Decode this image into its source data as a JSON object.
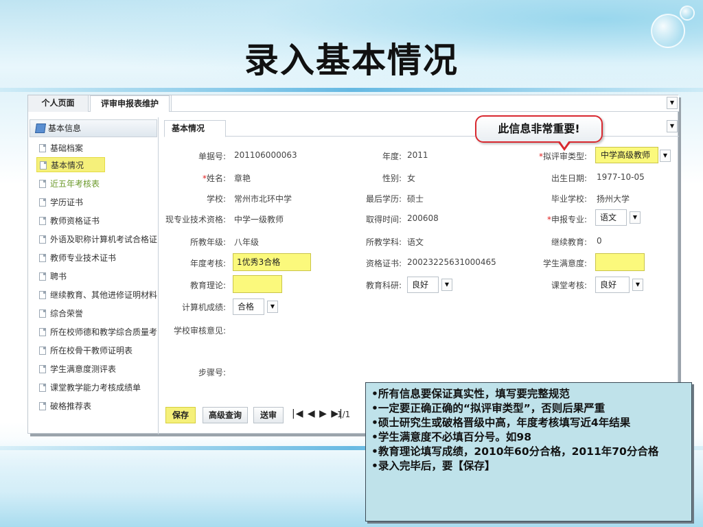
{
  "slide": {
    "title": "录入基本情况"
  },
  "app": {
    "top_tabs": [
      "个人页面",
      "评审申报表维护"
    ],
    "sidebar": {
      "header": "基本信息",
      "items": [
        {
          "label": "基础档案",
          "state": "normal"
        },
        {
          "label": "基本情况",
          "state": "active"
        },
        {
          "label": "近五年考核表",
          "state": "link"
        },
        {
          "label": "学历证书",
          "state": "normal"
        },
        {
          "label": "教师资格证书",
          "state": "normal"
        },
        {
          "label": "外语及职称计算机考试合格证书",
          "state": "normal"
        },
        {
          "label": "教师专业技术证书",
          "state": "normal"
        },
        {
          "label": "聘书",
          "state": "normal"
        },
        {
          "label": "继续教育、其他进修证明材料",
          "state": "normal"
        },
        {
          "label": "综合荣誉",
          "state": "normal"
        },
        {
          "label": "所在校师德和教学综合质量考核",
          "state": "normal"
        },
        {
          "label": "所在校骨干教师证明表",
          "state": "normal"
        },
        {
          "label": "学生满意度测评表",
          "state": "normal"
        },
        {
          "label": "课堂教学能力考核成绩单",
          "state": "normal"
        },
        {
          "label": "破格推荐表",
          "state": "normal"
        }
      ]
    },
    "main_tab": "基本情况",
    "form": {
      "danju_label": "单据号:",
      "danju_value": "201106000063",
      "niandu_label": "年度:",
      "niandu_value": "2011",
      "nipingshen_label": "拟评审类型:",
      "nipingshen_value": "中学高级教师",
      "xingming_label": "姓名:",
      "xingming_value": "章艳",
      "xingbie_label": "性别:",
      "xingbie_value": "女",
      "chusheng_label": "出生日期:",
      "chusheng_value": "1977-10-05",
      "xuexiao_label": "学校:",
      "xuexiao_value": "常州市北环中学",
      "zuihou_label": "最后学历:",
      "zuihou_value": "硕士",
      "biye_label": "毕业学校:",
      "biye_value": "扬州大学",
      "xianzhuanye_label": "现专业技术资格:",
      "xianzhuanye_value": "中学一级教师",
      "qude_label": "取得时间:",
      "qude_value": "200608",
      "shenbao_label": "申报专业:",
      "shenbao_value": "语文",
      "suojiao_nianji_label": "所教年级:",
      "suojiao_nianji_value": "八年级",
      "suojiao_xueke_label": "所教学科:",
      "suojiao_xueke_value": "语文",
      "jixu_label": "继续教育:",
      "jixu_value": "0",
      "kaohe_label": "年度考核:",
      "kaohe_value": "1优秀3合格",
      "zige_label": "资格证书:",
      "zige_value": "20023225631000465",
      "manyi_label": "学生满意度:",
      "manyi_value": "",
      "lilun_label": "教育理论:",
      "lilun_value": "",
      "keyan_label": "教育科研:",
      "keyan_value": "良好",
      "ketang_label": "课堂考核:",
      "ketang_value": "良好",
      "jisuanji_label": "计算机成绩:",
      "jisuanji_value": "合格",
      "shenhe_label": "学校审核意见:",
      "buzhou_label": "步骤号:"
    },
    "buttons": {
      "save": "保存",
      "query": "高级查询",
      "send": "送审"
    },
    "pager": {
      "controls": "|◀ ◀ ▶ ▶|",
      "page": "1/1"
    }
  },
  "callout": "此信息非常重要!",
  "notes": [
    "•所有信息要保证真实性，填写要完整规范",
    "•一定要正确正确的“拟评审类型”，否则后果严重",
    "•硕士研究生或破格晋级中高，年度考核填写近4年结果",
    "•学生满意度不必填百分号。如98",
    "•教育理论填写成绩，2010年60分合格，2011年70分合格",
    "•录入完毕后，要【保存】"
  ]
}
